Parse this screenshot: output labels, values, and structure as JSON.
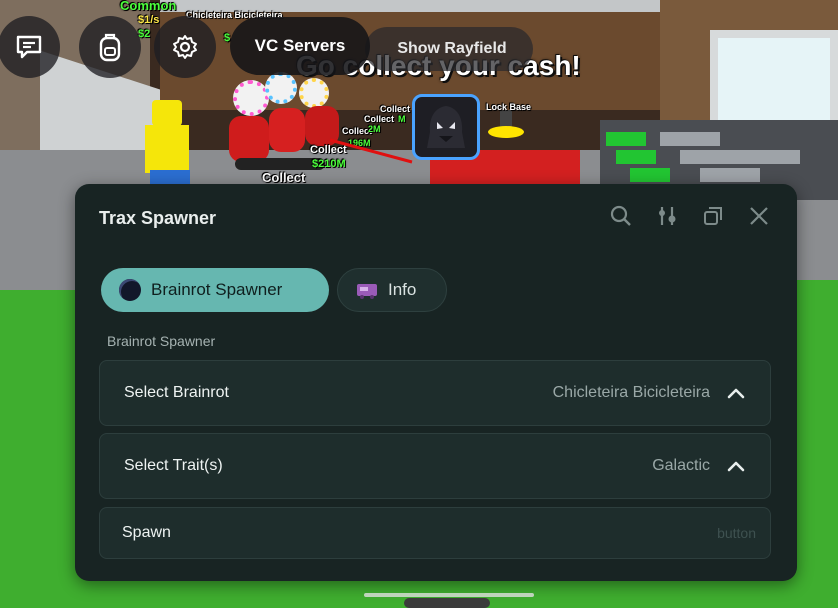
{
  "scene": {
    "billboard_rarity": "Common",
    "billboard_rate": "$1/s",
    "billboard_price": "$2",
    "billboard_name": "Chicleteira Bicicleteira",
    "billboard_price_b": "$",
    "center_message": "Go collect your cash!",
    "collect_labels": [
      "Collect",
      "Collect",
      "Collect",
      "Collect",
      "Collect"
    ],
    "money_labels": [
      "$210M",
      "196M",
      "2M",
      "M"
    ],
    "lock_base_label": "Lock Base"
  },
  "topbar": {
    "chat_icon": "chat-icon",
    "backpack_icon": "backpack-icon",
    "settings_icon": "gear-icon",
    "vc_servers_label": "VC Servers",
    "show_rayfield_label": "Show Rayfield"
  },
  "window": {
    "title": "Trax Spawner",
    "icons": [
      "search-icon",
      "sliders-icon",
      "minimize-icon",
      "close-icon"
    ],
    "tabs": [
      {
        "label": "Brainrot Spawner",
        "icon": "brainrot-icon",
        "active": true
      },
      {
        "label": "Info",
        "icon": "info-tab-icon",
        "active": false
      }
    ],
    "section_label": "Brainrot Spawner",
    "select_brainrot": {
      "label": "Select Brainrot",
      "value": "Chicleteira Bicicleteira"
    },
    "select_traits": {
      "label": "Select Trait(s)",
      "value": "Galactic"
    },
    "spawn": {
      "label": "Spawn",
      "hint": "button"
    }
  },
  "colors": {
    "window_bg": "#182423",
    "tab_active": "#66b7b0",
    "row_bg": "#1e2d2c",
    "annotation_arrow": "#e01010"
  }
}
